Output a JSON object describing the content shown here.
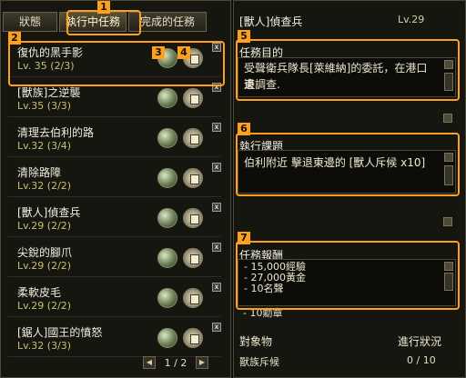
{
  "tabs": [
    "狀態",
    "執行中任務",
    "完成的任務"
  ],
  "quests": [
    {
      "title": "復仇的黑手影",
      "level": "Lv. 35 (2/3)"
    },
    {
      "title": "[獸族]之逆襲",
      "level": "Lv.35 (3/3)"
    },
    {
      "title": "清理去伯利的路",
      "level": "Lv.32 (3/4)"
    },
    {
      "title": "清除路障",
      "level": "Lv.32 (2/2)"
    },
    {
      "title": "[獸人]偵查兵",
      "level": "Lv.29 (2/2)"
    },
    {
      "title": "尖銳的腳爪",
      "level": "Lv.29 (2/2)"
    },
    {
      "title": "柔軟皮毛",
      "level": "Lv.29 (2/2)"
    },
    {
      "title": "[鋸人]國王的憤怒",
      "level": "Lv.32 (3/3)"
    }
  ],
  "pager": "1 / 2",
  "detail": {
    "title": "[獸人]偵查兵",
    "level": "Lv.29",
    "goal_header": "任務目的",
    "goal_text_1": "受聲衛兵隊長[萊維納]的委託，在港口東",
    "goal_text_2": "邊調查.",
    "task_header": "執行課題",
    "task_text": "伯利附近 擊退東邊的 [獸人斥候 x10]",
    "reward_header": "任務報酬",
    "rewards": [
      "- 15,000經驗",
      "- 27,000黃金",
      "- 10名聲",
      "- 10勳章"
    ],
    "target_label": "對象物",
    "progress_label": "進行狀況",
    "target_value": "獸族斥候",
    "progress_value": "0 / 10"
  },
  "callouts": [
    "1",
    "2",
    "3",
    "4",
    "5",
    "6",
    "7"
  ],
  "accent_color": "#ff9f1a"
}
